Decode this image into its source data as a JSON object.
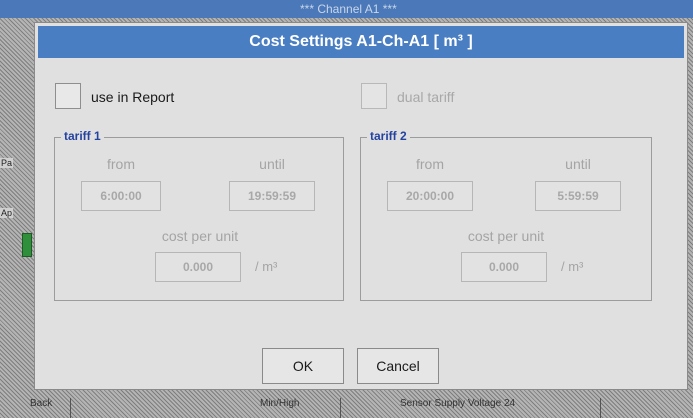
{
  "background_window": {
    "title": "*** Channel A1 ***",
    "side_labels": [
      "Pa",
      "Ap"
    ],
    "bottom_items": [
      "Back",
      "",
      "Min/High",
      "",
      "Sensor Supply Voltage 24"
    ]
  },
  "dialog": {
    "title": "Cost Settings A1-Ch-A1 [ m³ ]",
    "use_in_report": {
      "label": "use in Report",
      "checked": false
    },
    "dual_tariff": {
      "label": "dual tariff",
      "checked": false,
      "disabled": true
    },
    "tariff1": {
      "legend": "tariff 1",
      "from_label": "from",
      "until_label": "until",
      "from_value": "6:00:00",
      "until_value": "19:59:59",
      "cost_label": "cost per unit",
      "cost_value": "0.000",
      "unit": "/ m³"
    },
    "tariff2": {
      "legend": "tariff 2",
      "from_label": "from",
      "until_label": "until",
      "from_value": "20:00:00",
      "until_value": "5:59:59",
      "cost_label": "cost per unit",
      "cost_value": "0.000",
      "unit": "/ m³"
    },
    "ok_label": "OK",
    "cancel_label": "Cancel"
  },
  "colors": {
    "title_bar": "#4a7ec2",
    "legend_text": "#2443a0",
    "disabled_text": "#a4a4a4"
  }
}
